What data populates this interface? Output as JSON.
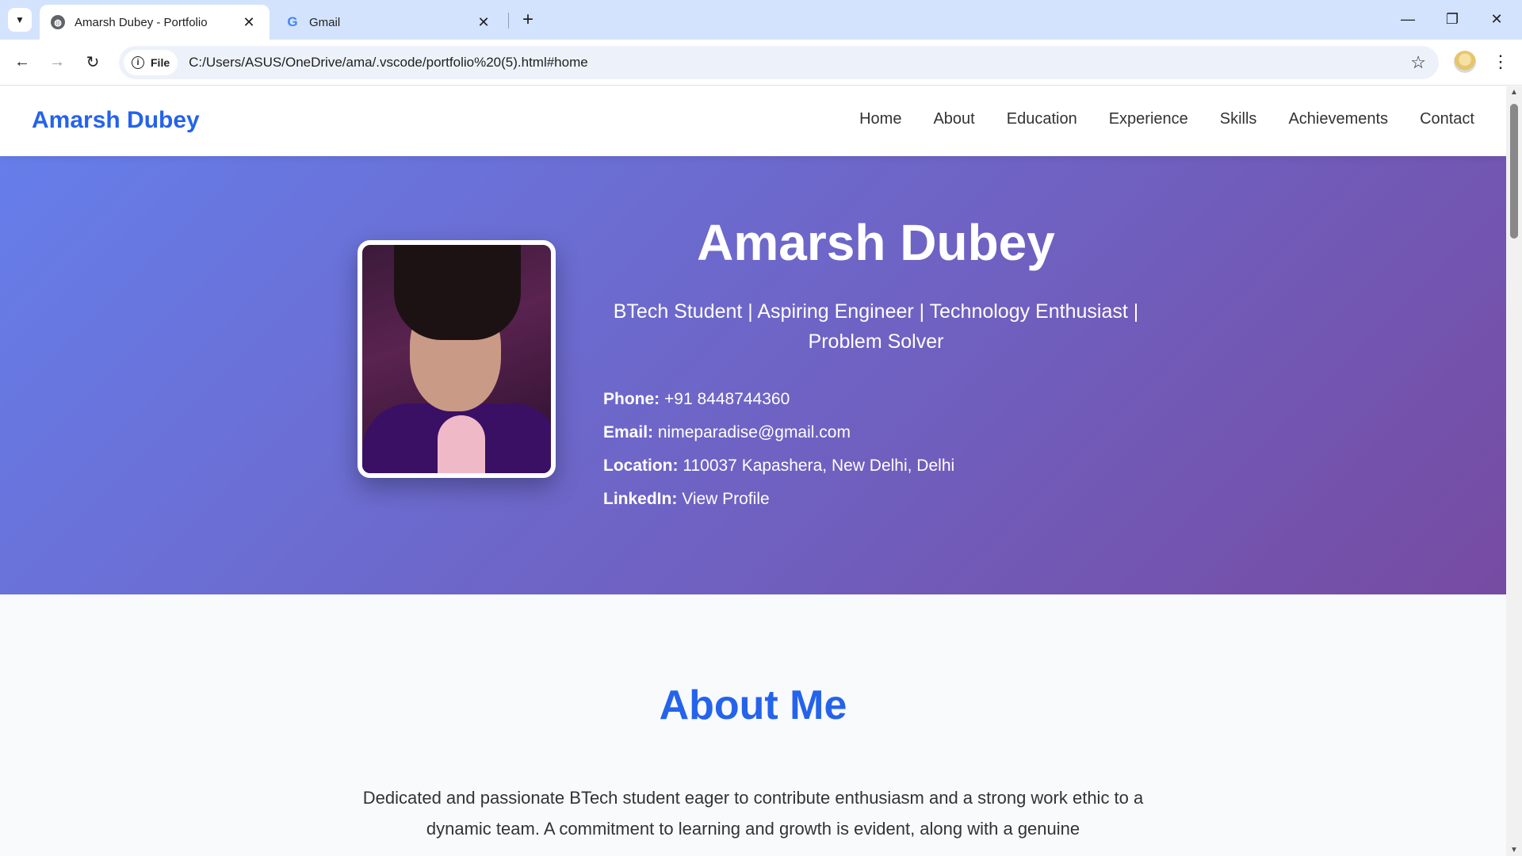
{
  "browser": {
    "tabs": [
      {
        "title": "Amarsh Dubey - Portfolio",
        "active": true,
        "icon": "globe-icon"
      },
      {
        "title": "Gmail",
        "active": false,
        "icon": "google-icon"
      }
    ],
    "address": {
      "chip_label": "File",
      "url": "C:/Users/ASUS/OneDrive/ama/.vscode/portfolio%20(5).html#home"
    }
  },
  "site": {
    "logo": "Amarsh Dubey",
    "nav": [
      "Home",
      "About",
      "Education",
      "Experience",
      "Skills",
      "Achievements",
      "Contact"
    ]
  },
  "hero": {
    "name": "Amarsh Dubey",
    "tagline": "BTech Student | Aspiring Engineer | Technology Enthusiast | Problem Solver",
    "contact": {
      "phone_label": "Phone:",
      "phone": "+91 8448744360",
      "email_label": "Email:",
      "email": "nimeparadise@gmail.com",
      "location_label": "Location:",
      "location": "110037 Kapashera, New Delhi, Delhi",
      "linkedin_label": "LinkedIn:",
      "linkedin": "View Profile"
    }
  },
  "about": {
    "title": "About Me",
    "text": "Dedicated and passionate BTech student eager to contribute enthusiasm and a strong work ethic to a dynamic team. A commitment to learning and growth is evident, along with a genuine"
  },
  "colors": {
    "accent": "#2563eb",
    "hero_gradient_start": "#667eea",
    "hero_gradient_end": "#764ba2"
  }
}
